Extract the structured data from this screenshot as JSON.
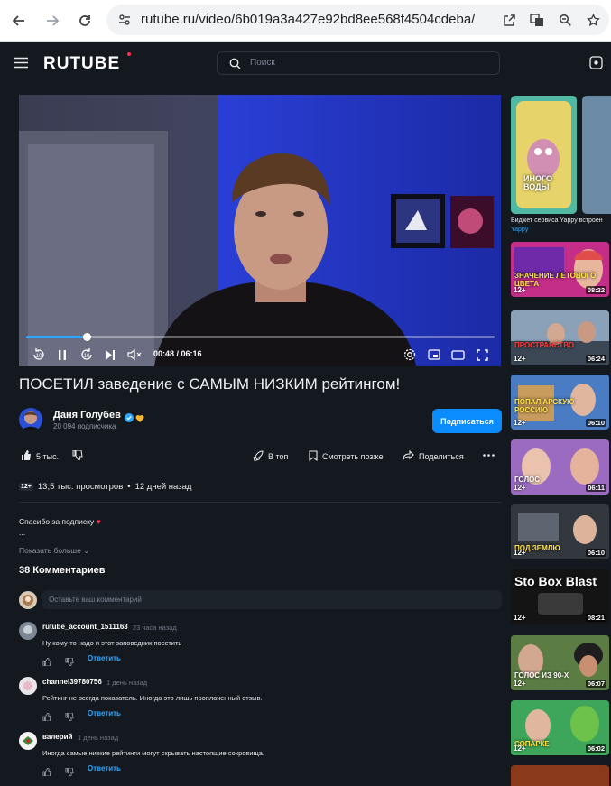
{
  "browser": {
    "url": "rutube.ru/video/6b019a3a427e92bd8ee568f4504cdeba/",
    "icons": [
      "back-icon",
      "forward-icon",
      "reload-icon",
      "site-settings-icon",
      "open-external-icon",
      "translate-icon",
      "zoom-icon",
      "bookmark-star-icon"
    ]
  },
  "header": {
    "logo": "RUTUBE",
    "search_placeholder": "Поиск"
  },
  "player": {
    "current_time": "00:48",
    "duration": "06:16",
    "time_display": "00:48 / 06:16",
    "progress": 0.13,
    "rewind_label": "10",
    "forward_label": "10"
  },
  "video": {
    "title": "ПОСЕТИЛ заведение с САМЫМ НИЗКИМ рейтингом!",
    "channel_name": "Даня Голубев",
    "subscribers": "20 094 подписчика",
    "subscribe_label": "Подписаться",
    "likes": "5 тыс.",
    "top_label": "В топ",
    "watch_later_label": "Смотреть позже",
    "share_label": "Поделиться",
    "age_rating": "12+",
    "views": "13,5 тыс. просмотров",
    "posted": "12 дней назад",
    "description_line1": "Спасибо за подписку",
    "description_line2": "...",
    "show_more": "Показать больше"
  },
  "comments": {
    "title": "38 Комментариев",
    "input_placeholder": "Оставьте ваш комментарий",
    "reply_label": "Ответить",
    "items": [
      {
        "author": "rutube_account_1511163",
        "time": "23 часа назад",
        "text": "Ну кому-то надо и этот заповедник посетить"
      },
      {
        "author": "channel39780756",
        "time": "1 день назад",
        "text": "Рейтинг не всегда показатель. Иногда это лишь проплаченный отзыв."
      },
      {
        "author": "валерий",
        "time": "1 день назад",
        "text": "Иногда самые низкие рейтинги могут скрывать настоящие сокровища."
      }
    ]
  },
  "sidebar": {
    "ad_caption": "Виджет сервиса Yappy встроен",
    "ad_brand": "Yappy",
    "ad_thumb_text": "ИНОГО ВОДЫ",
    "videos": [
      {
        "age": "12+",
        "duration": "08:22",
        "caption": "ЗНАЧЕНИЕ ЛЕТОВОГО ЦВЕТА"
      },
      {
        "age": "12+",
        "duration": "06:24",
        "caption": "ПРОСТРАНСТВО"
      },
      {
        "age": "12+",
        "duration": "06:10",
        "caption": "ПОПАЛ АРСКУЮ РОССИЮ"
      },
      {
        "age": "12+",
        "duration": "06:11",
        "caption": "ГОЛОС"
      },
      {
        "age": "12+",
        "duration": "06:10",
        "caption": "ПОД ЗЕМЛЮ"
      },
      {
        "age": "12+",
        "duration": "08:21",
        "caption": "Sto Box Blast"
      },
      {
        "age": "12+",
        "duration": "06:07",
        "caption": "ГОЛОС ИЗ 90-Х"
      },
      {
        "age": "12+",
        "duration": "06:02",
        "caption": "СОПАРКЕ"
      }
    ]
  }
}
